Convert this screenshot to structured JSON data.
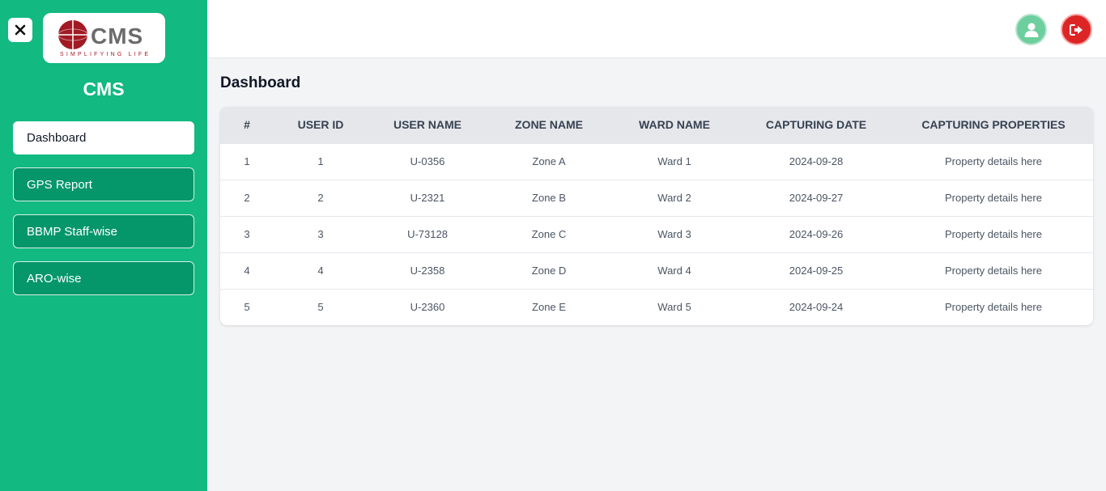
{
  "sidebar": {
    "brand": "CMS",
    "logo": {
      "text": "CMS",
      "tagline": "SIMPLIFYING LIFE"
    },
    "items": [
      {
        "label": "Dashboard",
        "active": true
      },
      {
        "label": "GPS Report",
        "active": false
      },
      {
        "label": "BBMP Staff-wise",
        "active": false
      },
      {
        "label": "ARO-wise",
        "active": false
      }
    ]
  },
  "header": {
    "icons": [
      "close-icon",
      "user-icon",
      "logout-icon"
    ],
    "colors": {
      "sidebar": "#12b981",
      "avatar": "#6ccf9d",
      "logout": "#dc2626"
    }
  },
  "main": {
    "title": "Dashboard",
    "table": {
      "columns": [
        "#",
        "USER ID",
        "USER NAME",
        "ZONE NAME",
        "WARD NAME",
        "CAPTURING DATE",
        "CAPTURING PROPERTIES"
      ],
      "rows": [
        [
          "1",
          "1",
          "U-0356",
          "Zone A",
          "Ward 1",
          "2024-09-28",
          "Property details here"
        ],
        [
          "2",
          "2",
          "U-2321",
          "Zone B",
          "Ward 2",
          "2024-09-27",
          "Property details here"
        ],
        [
          "3",
          "3",
          "U-73128",
          "Zone C",
          "Ward 3",
          "2024-09-26",
          "Property details here"
        ],
        [
          "4",
          "4",
          "U-2358",
          "Zone D",
          "Ward 4",
          "2024-09-25",
          "Property details here"
        ],
        [
          "5",
          "5",
          "U-2360",
          "Zone E",
          "Ward 5",
          "2024-09-24",
          "Property details here"
        ]
      ]
    }
  }
}
